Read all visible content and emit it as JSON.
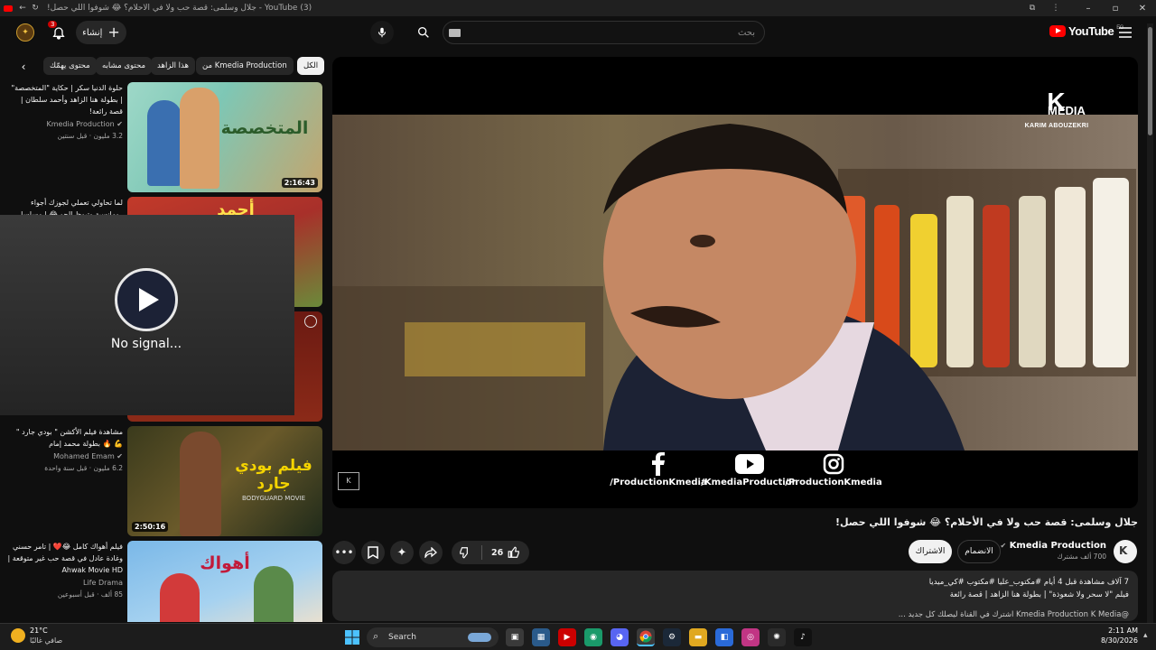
{
  "browser": {
    "tab_title": "(3) YouTube - جلال وسلمى: قصة حب ولا في الأحلام؟ 😂 شوفوا اللي حصل!"
  },
  "masthead": {
    "create_label": "إنشاء",
    "notification_count": "3",
    "search_placeholder": "بحث",
    "logo_text": "YouTube",
    "logo_country": "EG"
  },
  "chips": [
    "الكل",
    "من Kmedia Production",
    "هذا الزاهد",
    "محتوى مشابه",
    "محتوى يهمّك"
  ],
  "recommendations": [
    {
      "title": "حلوة الدنيا سكر | حكاية \"المتخصصة\" | بطولة هنا الزاهد وأحمد سلطان | قصة رائعة!",
      "channel": "Kmedia Production",
      "meta": "3.2 مليون · قبل سنتين",
      "duration": "2:16:43",
      "thumb_text": "المتخصصة"
    },
    {
      "title": "لما تحاولي تعملي لجوزك أجواء رومانسية وتبوظ الجو 😂 | مسلسل",
      "channel": "",
      "meta": "",
      "duration": "",
      "thumb_text": "أحمد"
    },
    {
      "title": "",
      "channel": "",
      "meta": "",
      "duration": "",
      "thumb_text": ""
    },
    {
      "title": "مشاهدة فيلم الأكشن \" بودي جارد \" 💪 🔥 بطولة محمد إمام",
      "channel": "Mohamed Emam",
      "meta": "6.2 مليون · قبل سنة واحدة",
      "duration": "2:50:16",
      "thumb_text": "فيلم بودي جارد",
      "thumb_sub": "BODYGUARD MOVIE"
    },
    {
      "title": "فيلم أهواك كامل 😂❤️ | تامر حسني وغادة عادل في قصة حب غير متوقعة | Ahwak Movie HD",
      "channel": "Life Drama",
      "meta": "85 ألف · قبل أسبوعين",
      "duration": "",
      "thumb_text": "أهواك"
    }
  ],
  "no_signal": {
    "text": "No signal..."
  },
  "player": {
    "brand_k": "K",
    "brand_media": "MEDIA",
    "brand_name": "KARIM ABOUZEKRI",
    "socials": [
      {
        "icon": "facebook-icon",
        "handle": "/ProductionKmedia"
      },
      {
        "icon": "youtube-icon",
        "handle": "/KmediaProduction"
      },
      {
        "icon": "instagram-icon",
        "handle": "/ProductionKmedia"
      }
    ]
  },
  "video": {
    "title": "جلال وسلمى: قصة حب ولا في الأحلام؟ 😂 شوفوا اللي حصل!",
    "channel": "Kmedia Production",
    "subscribers": "700 ألف مشترك",
    "join_label": "الانضمام",
    "subscribe_label": "الاشتراك",
    "likes": "26"
  },
  "description": {
    "line1": "7 آلاف مشاهدة  قبل 4 أيام  #مكتوب_عليا  #مكتوب  #كي_ميديا",
    "line2": "فيلم \"لا سحر ولا شعوذة\" | بطولة هنا الزاهد | قصة رائعة",
    "line3": "@Kmedia Production  K Media  اشترك في القناة ليصلك كل جديد ..."
  },
  "taskbar": {
    "search_label": "Search",
    "weather_temp": "21°C",
    "weather_desc": "صافي غالبًا",
    "time": "2:11 AM",
    "date": "8/30/2026"
  },
  "colors": {
    "accent": "#ff0000",
    "background": "#0f0f0f",
    "chip": "#272727"
  }
}
